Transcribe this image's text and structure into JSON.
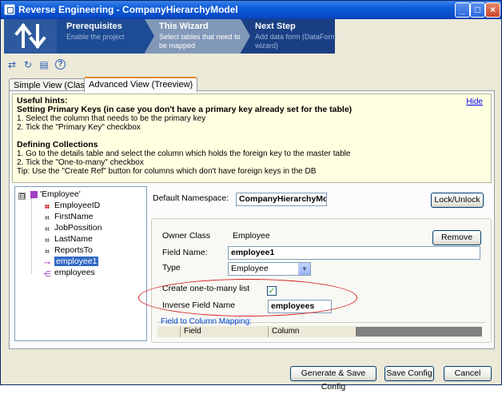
{
  "window": {
    "title": "Reverse Engineering - CompanyHierarchyModel",
    "controls": {
      "minimize": "_",
      "maximize": "□",
      "close": "×"
    }
  },
  "wizard": {
    "steps": [
      {
        "title": "Prerequisites",
        "desc": "Enable the project"
      },
      {
        "title": "This Wizard",
        "desc": "Select tables that need to be mapped"
      },
      {
        "title": "Next Step",
        "desc": "Add data form (DataForm wizard)"
      }
    ]
  },
  "toolbar": {
    "icons": [
      "map-icon",
      "refresh-icon",
      "document-icon",
      "help-icon"
    ],
    "glyphs": [
      "⇄",
      "↻",
      "▤",
      "?"
    ]
  },
  "tabs": [
    {
      "label": "Simple View (Classes)"
    },
    {
      "label": "Advanced View (Treeview)"
    }
  ],
  "hints": {
    "title": "Useful hints:",
    "primary_keys_title": "Setting Primary Keys (in case you don't have a primary key already set for the table)",
    "pk_steps": [
      "1. Select the column that needs to be the primary key",
      "2. Tick the \"Primary Key\" checkbox"
    ],
    "collections_title": "Defining Collections",
    "collection_steps": [
      "1. Go to the details table and select the column which holds the foreign key to the master table",
      "2. Tick the \"One-to-many\" checkbox",
      "Tip: Use the \"Create Ref\" button for columns which don't have foreign keys in the DB"
    ],
    "hide_link": "Hide"
  },
  "tree": {
    "expander": "⊟",
    "root": "'Employee'",
    "items": [
      "EmployeeID",
      "FirstName",
      "JobPossition",
      "LastName",
      "ReportsTo",
      "employee1",
      "employees"
    ]
  },
  "form": {
    "namespace_label": "Default Namespace:",
    "namespace_value": "CompanyHierarchyMod",
    "lock_button": "Lock/Unlock",
    "owner_class_label": "Owner Class",
    "owner_class_value": "Employee",
    "remove_button": "Remove",
    "field_name_label": "Field Name:",
    "field_name_value": "employee1",
    "type_label": "Type",
    "type_value": "Employee",
    "one_to_many_label": "Create one-to-many list",
    "one_to_many_checked": "✓",
    "inverse_label": "Inverse Field Name",
    "inverse_value": "employees",
    "mapping_legend": "Field to Column Mapping:",
    "mapping_columns": [
      "Field",
      "Column"
    ]
  },
  "footer": {
    "generate_button": "Generate & Save Config",
    "save_button": "Save Config",
    "cancel_button": "Cancel"
  },
  "colors": {
    "titlebar": "#0a4cc7",
    "wizard_active": "#8298b8",
    "highlight": "#d42020",
    "selection": "#316ac5"
  }
}
